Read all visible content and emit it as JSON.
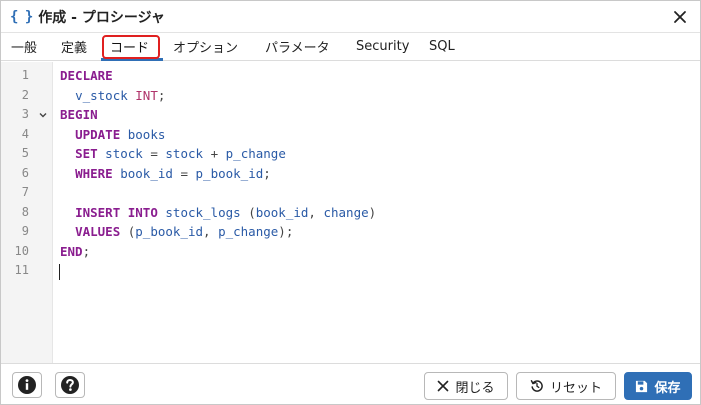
{
  "window": {
    "title_icon": "{ }",
    "title": "作成 - プロシージャ"
  },
  "tabs": [
    {
      "label": "一般"
    },
    {
      "label": "定義"
    },
    {
      "label": "コード"
    },
    {
      "label": "オプション"
    },
    {
      "label": "パラメータ"
    },
    {
      "label": "Security"
    },
    {
      "label": "SQL"
    }
  ],
  "active_tab": "コード",
  "editor": {
    "line_numbers": [
      "1",
      "2",
      "3",
      "4",
      "5",
      "6",
      "7",
      "8",
      "9",
      "10",
      "11"
    ],
    "lines": [
      "DECLARE",
      "  v_stock INT;",
      "BEGIN",
      "  UPDATE books",
      "  SET stock = stock + p_change",
      "  WHERE book_id = p_book_id;",
      "",
      "  INSERT INTO stock_logs (book_id, change)",
      "  VALUES (p_book_id, p_change);",
      "END;",
      ""
    ]
  },
  "footer": {
    "close_label": "閉じる",
    "reset_label": "リセット",
    "save_label": "保存"
  },
  "colors": {
    "accent": "#2f6fb6",
    "highlight": "#e02020",
    "keyword": "#8a1d8f",
    "identifier": "#2a5aa6"
  }
}
